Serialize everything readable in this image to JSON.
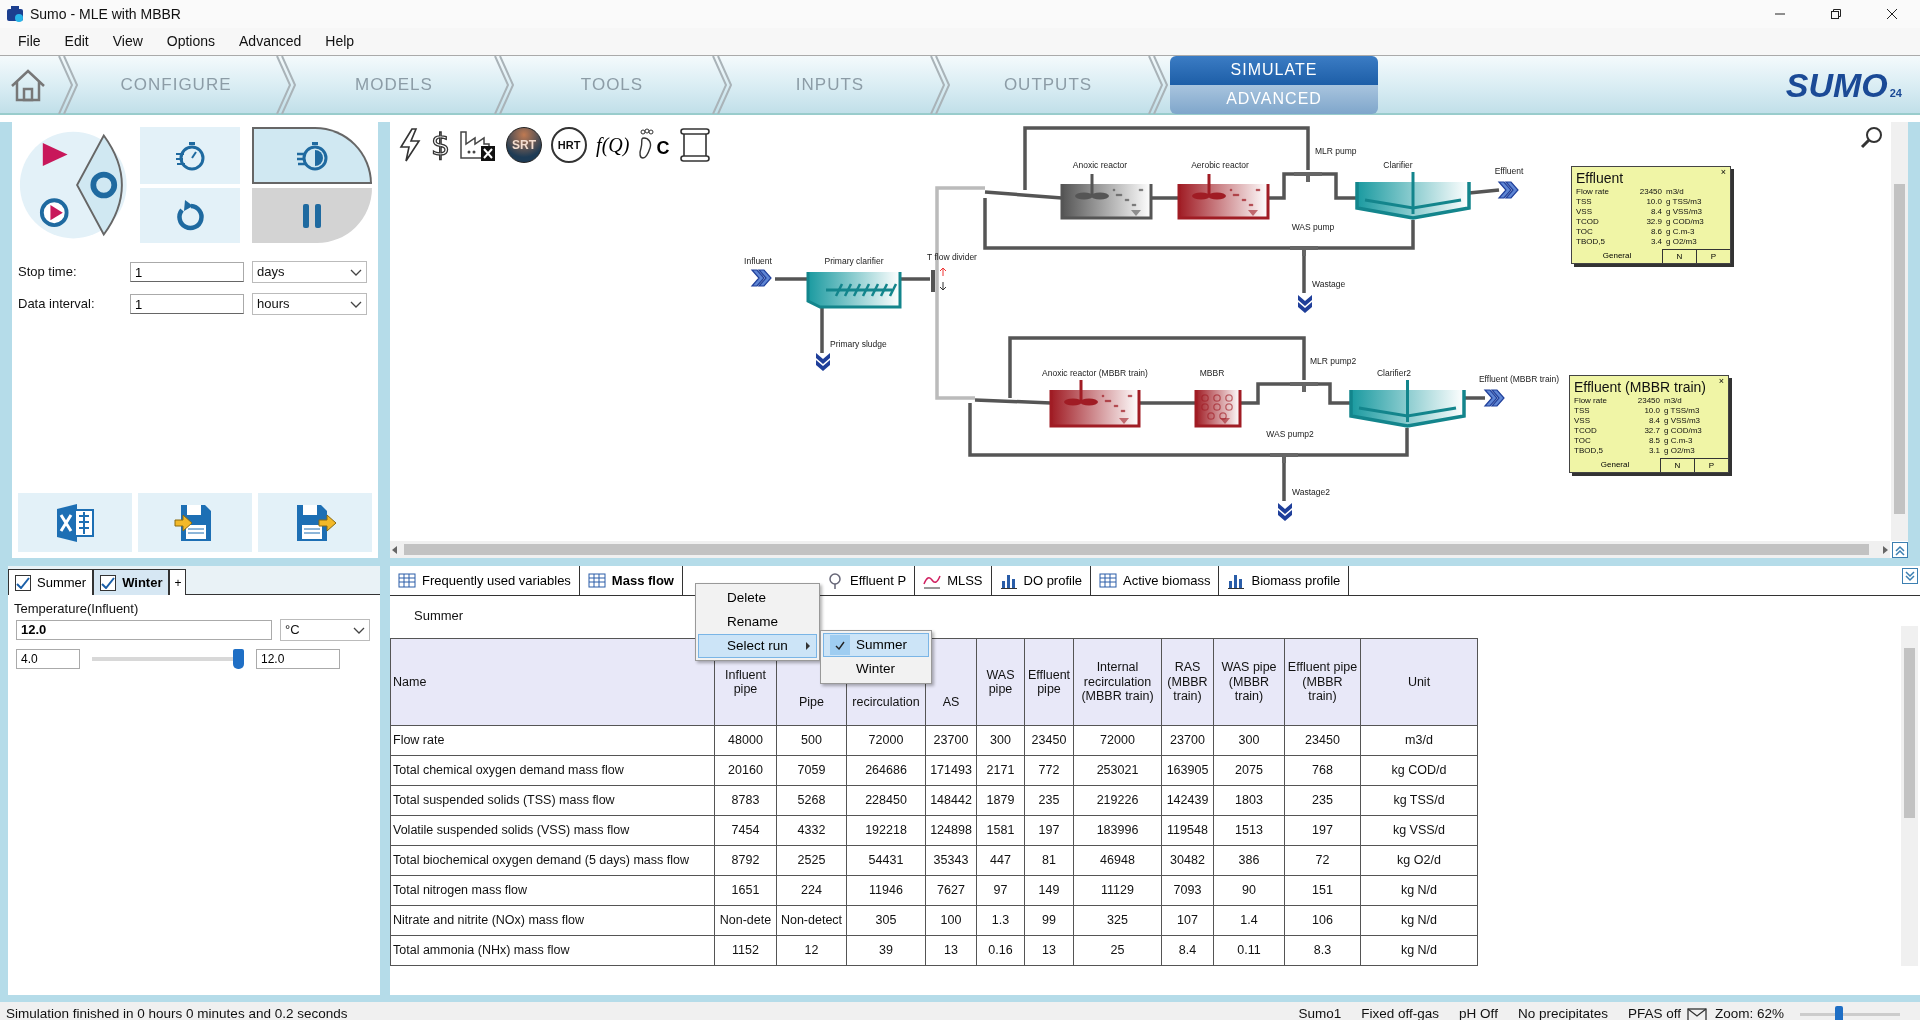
{
  "window": {
    "title": "Sumo - MLE with MBBR"
  },
  "menu": [
    "File",
    "Edit",
    "View",
    "Options",
    "Advanced",
    "Help"
  ],
  "workflow_tabs": [
    {
      "label": "CONFIGURE",
      "selected": false
    },
    {
      "label": "MODELS",
      "selected": false
    },
    {
      "label": "TOOLS",
      "selected": false
    },
    {
      "label": "INPUTS",
      "selected": false
    },
    {
      "label": "OUTPUTS",
      "selected": false
    },
    {
      "label": "SIMULATE",
      "selected": true,
      "sub_label": "ADVANCED"
    }
  ],
  "logo": {
    "text": "SUMO",
    "version": "24"
  },
  "simulation": {
    "stop_time": {
      "label": "Stop time:",
      "value": "1",
      "unit": "days"
    },
    "data_interval": {
      "label": "Data interval:",
      "value": "1",
      "unit": "hours"
    }
  },
  "diagram_toolbar": {
    "cost": "$",
    "srt": "SRT",
    "hrt": "HRT",
    "fq": "f(Q)",
    "footprint": "C"
  },
  "flowsheet": {
    "units": [
      {
        "kind": "influent",
        "label": "Influent"
      },
      {
        "kind": "primary_clarifier",
        "label": "Primary clarifier"
      },
      {
        "kind": "wastage",
        "label": "Primary sludge"
      },
      {
        "kind": "splitter",
        "label": "T flow divider"
      },
      {
        "kind": "reactor",
        "label": "Anoxic reactor",
        "color": "#555555"
      },
      {
        "kind": "reactor",
        "label": "Aerobic reactor",
        "color": "#a01c24"
      },
      {
        "kind": "pump",
        "label": "MLR pump"
      },
      {
        "kind": "clarifier",
        "label": "Clarifier"
      },
      {
        "kind": "effluent",
        "label": "Effluent"
      },
      {
        "kind": "pump",
        "label": "WAS pump"
      },
      {
        "kind": "wastage",
        "label": "Wastage"
      },
      {
        "kind": "reactor",
        "label": "Anoxic reactor (MBBR train)",
        "color": "#a01c24"
      },
      {
        "kind": "mbbr",
        "label": "MBBR",
        "color": "#a01c24"
      },
      {
        "kind": "pump",
        "label": "MLR pump2"
      },
      {
        "kind": "clarifier",
        "label": "Clarifier2"
      },
      {
        "kind": "effluent",
        "label": "Effluent (MBBR train)"
      },
      {
        "kind": "pump",
        "label": "WAS pump2"
      },
      {
        "kind": "wastage",
        "label": "Wastage2"
      }
    ]
  },
  "effluent_panels": [
    {
      "title": "Effluent",
      "close": "×",
      "rows": [
        {
          "name": "Flow rate",
          "value": "23450",
          "unit": "m3/d"
        },
        {
          "name": "TSS",
          "value": "10.0",
          "unit": "g TSS/m3"
        },
        {
          "name": "VSS",
          "value": "8.4",
          "unit": "g VSS/m3"
        },
        {
          "name": "TCOD",
          "value": "32.9",
          "unit": "g COD/m3"
        },
        {
          "name": "TOC",
          "value": "8.6",
          "unit": "g C.m-3"
        },
        {
          "name": "TBOD,5",
          "value": "3.4",
          "unit": "g O2/m3"
        }
      ],
      "tabs": [
        {
          "label": "General",
          "selected": true
        },
        {
          "label": "N",
          "selected": false
        },
        {
          "label": "P",
          "selected": false
        }
      ]
    },
    {
      "title": "Effluent (MBBR train)",
      "close": "×",
      "rows": [
        {
          "name": "Flow rate",
          "value": "23450",
          "unit": "m3/d"
        },
        {
          "name": "TSS",
          "value": "10.0",
          "unit": "g TSS/m3"
        },
        {
          "name": "VSS",
          "value": "8.4",
          "unit": "g VSS/m3"
        },
        {
          "name": "TCOD",
          "value": "32.7",
          "unit": "g COD/m3"
        },
        {
          "name": "TOC",
          "value": "8.5",
          "unit": "g C.m-3"
        },
        {
          "name": "TBOD,5",
          "value": "3.1",
          "unit": "g O2/m3"
        }
      ],
      "tabs": [
        {
          "label": "General",
          "selected": true
        },
        {
          "label": "N",
          "selected": false
        },
        {
          "label": "P",
          "selected": false
        }
      ]
    }
  ],
  "scenarios": {
    "tabs": [
      {
        "label": "Summer",
        "checked": true,
        "selected": false
      },
      {
        "label": "Winter",
        "checked": true,
        "selected": true
      }
    ],
    "add": "+",
    "parameter": {
      "label": "Temperature(Influent)",
      "value": "12.0",
      "unit": "°C",
      "min": "4.0",
      "max": "12.0",
      "level": 0.97
    }
  },
  "result_tabs": [
    {
      "label": "Frequently used variables",
      "kind": "table",
      "selected": false
    },
    {
      "label": "Mass flow",
      "kind": "table",
      "selected": true
    },
    {
      "label": "Effluent P",
      "kind": "probe",
      "selected": false
    },
    {
      "label": "MLSS",
      "kind": "line",
      "selected": false
    },
    {
      "label": "DO profile",
      "kind": "bar",
      "selected": false
    },
    {
      "label": "Active biomass",
      "kind": "table",
      "selected": false
    },
    {
      "label": "Biomass profile",
      "kind": "bar",
      "selected": false
    }
  ],
  "run_label": "Summer",
  "table": {
    "columns": [
      "Name",
      "Influent pipe",
      "Pipe",
      "recirculation",
      "AS",
      "WAS pipe",
      "Effluent pipe",
      "Internal recirculation (MBBR train)",
      "RAS (MBBR train)",
      "WAS pipe (MBBR train)",
      "Effluent pipe (MBBR train)",
      "Unit"
    ],
    "rows": [
      {
        "name": "Flow rate",
        "values": [
          "48000",
          "500",
          "72000",
          "23700",
          "300",
          "23450",
          "72000",
          "23700",
          "300",
          "23450"
        ],
        "unit": "m3/d"
      },
      {
        "name": "Total chemical oxygen demand mass flow",
        "values": [
          "20160",
          "7059",
          "264686",
          "171493",
          "2171",
          "772",
          "253021",
          "163905",
          "2075",
          "768"
        ],
        "unit": "kg COD/d"
      },
      {
        "name": "Total suspended solids (TSS) mass flow",
        "values": [
          "8783",
          "5268",
          "228450",
          "148442",
          "1879",
          "235",
          "219226",
          "142439",
          "1803",
          "235"
        ],
        "unit": "kg TSS/d"
      },
      {
        "name": "Volatile suspended solids (VSS) mass flow",
        "values": [
          "7454",
          "4332",
          "192218",
          "124898",
          "1581",
          "197",
          "183996",
          "119548",
          "1513",
          "197"
        ],
        "unit": "kg VSS/d"
      },
      {
        "name": "Total biochemical oxygen demand (5 days) mass flow",
        "values": [
          "8792",
          "2525",
          "54431",
          "35343",
          "447",
          "81",
          "46948",
          "30482",
          "386",
          "72"
        ],
        "unit": "kg O2/d"
      },
      {
        "name": "Total nitrogen mass flow",
        "values": [
          "1651",
          "224",
          "11946",
          "7627",
          "97",
          "149",
          "11129",
          "7093",
          "90",
          "151"
        ],
        "unit": "kg N/d"
      },
      {
        "name": "Nitrate and nitrite (NOx) mass flow",
        "values": [
          "Non-dete",
          "Non-detect",
          "305",
          "100",
          "1.3",
          "99",
          "325",
          "107",
          "1.4",
          "106"
        ],
        "unit": "kg N/d"
      },
      {
        "name": "Total ammonia (NHx) mass flow",
        "values": [
          "1152",
          "12",
          "39",
          "13",
          "0.16",
          "13",
          "25",
          "8.4",
          "0.11",
          "8.3"
        ],
        "unit": "kg N/d"
      }
    ]
  },
  "context_menu": {
    "items": [
      {
        "label": "Delete",
        "highlighted": false
      },
      {
        "label": "Rename",
        "highlighted": false
      },
      {
        "label": "Select run",
        "highlighted": true,
        "submenu": [
          {
            "label": "Summer",
            "checked": true,
            "highlighted": true
          },
          {
            "label": "Winter",
            "checked": false,
            "highlighted": false
          }
        ]
      }
    ]
  },
  "status_bar": {
    "message": "Simulation finished in 0 hours 0 minutes and 0.2 seconds",
    "items": [
      "Sumo1",
      "Fixed off-gas",
      "pH Off",
      "No precipitates",
      "PFAS off"
    ],
    "zoom": "Zoom: 62%",
    "zoom_slider": {
      "level": 0.39
    }
  }
}
